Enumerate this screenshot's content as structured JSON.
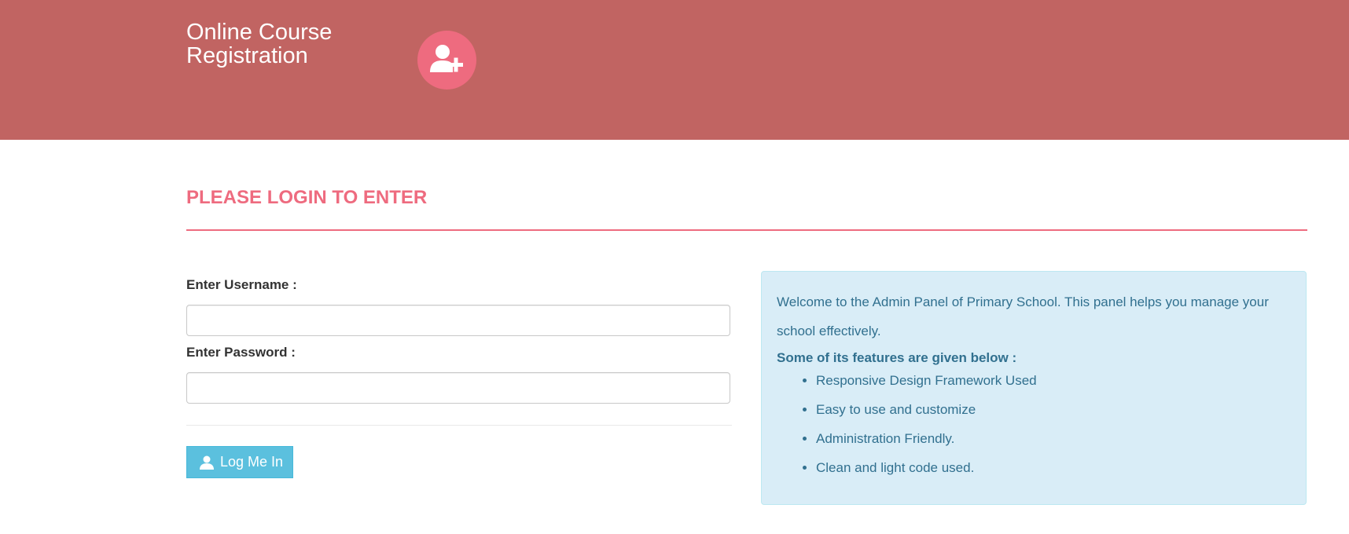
{
  "header": {
    "brand_line1": "Online Course",
    "brand_line2": "Registration",
    "logo_icon": "user-plus-icon",
    "background_color": "#c16462",
    "logo_color": "#ee6b7f"
  },
  "login": {
    "title": "PLEASE LOGIN TO ENTER",
    "username_label": "Enter Username :",
    "username_value": "",
    "password_label": "Enter Password :",
    "password_value": "",
    "button_label": "Log Me In",
    "button_icon": "user-icon"
  },
  "info": {
    "intro": "Welcome to the Admin Panel of Primary School. This panel helps you manage your school effectively.",
    "features_heading": "Some of its features are given below :",
    "features": [
      "Responsive Design Framework Used",
      "Easy to use and customize",
      "Administration Friendly.",
      "Clean and light code used."
    ]
  },
  "colors": {
    "accent": "#ee6b7f",
    "button": "#5bc0de",
    "info_bg": "#d9edf7",
    "info_text": "#31708f"
  }
}
